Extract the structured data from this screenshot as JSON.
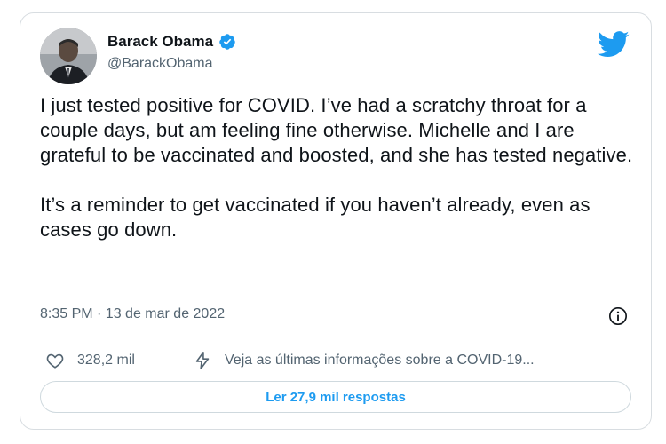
{
  "user": {
    "name": "Barack Obama",
    "handle": "@BarackObama",
    "verified": true
  },
  "tweet": {
    "paragraph1": "I just tested positive for COVID. I’ve had a scratchy throat for a couple days, but am feeling fine otherwise. Michelle and I are grateful to be vaccinated and boosted, and she has tested negative.",
    "paragraph2": "It’s a reminder to get vaccinated if you haven’t already, even as cases go down.",
    "timestamp": "8:35 PM · 13 de mar de 2022"
  },
  "actions": {
    "likes": "328,2 mil",
    "covid_info": "Veja as últimas informações sobre a COVID-19..."
  },
  "replies_button": "Ler 27,9 mil respostas",
  "icons": {
    "logo": "twitter-bird-icon",
    "verified": "verified-badge-icon",
    "info": "info-icon",
    "like": "heart-icon",
    "covid": "lightning-icon"
  },
  "colors": {
    "accent": "#1d9bf0",
    "text": "#0f1419",
    "muted": "#536471",
    "border": "#d8dde1"
  }
}
